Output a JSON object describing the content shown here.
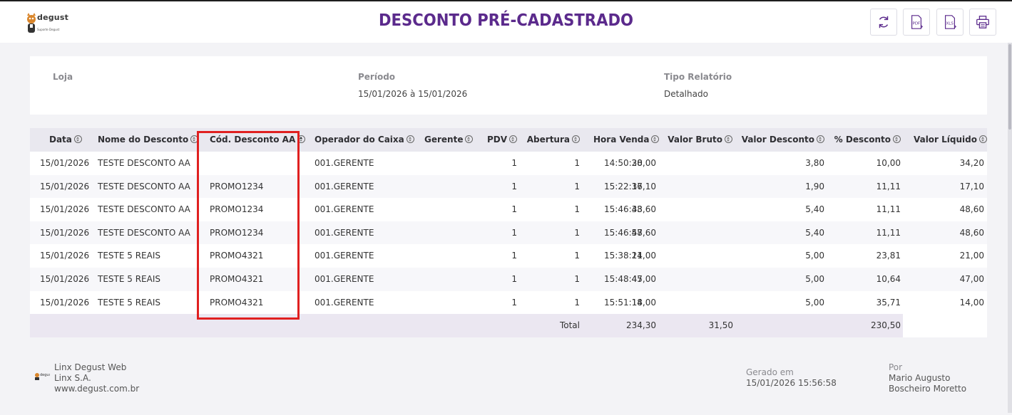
{
  "header": {
    "brand": "degust",
    "brand_sub": "Suporte Degust",
    "title": "DESCONTO PRÉ-CADASTRADO",
    "buttons": [
      "refresh-icon",
      "pdf-icon",
      "xls-icon",
      "print-icon"
    ]
  },
  "filters": {
    "loja_label": "Loja",
    "loja_value": "",
    "periodo_label": "Período",
    "periodo_value": "15/01/2026 à 15/01/2026",
    "tipo_label": "Tipo Relatório",
    "tipo_value": "Detalhado"
  },
  "table": {
    "columns": [
      "Data",
      "Nome do Desconto",
      "Cód. Desconto AA",
      "Operador do Caixa",
      "Gerente",
      "PDV",
      "Abertura",
      "Hora Venda",
      "Valor Bruto",
      "Valor Desconto",
      "% Desconto",
      "Valor Líquido"
    ],
    "rows": [
      [
        "15/01/2026",
        "TESTE DESCONTO AA",
        "",
        "001.GERENTE",
        "",
        "1",
        "1",
        "14:50:20",
        "38,00",
        "3,80",
        "10,00",
        "34,20"
      ],
      [
        "15/01/2026",
        "TESTE DESCONTO AA",
        "PROMO1234",
        "001.GERENTE",
        "",
        "1",
        "1",
        "15:22:36",
        "17,10",
        "1,90",
        "11,11",
        "17,10"
      ],
      [
        "15/01/2026",
        "TESTE DESCONTO AA",
        "PROMO1234",
        "001.GERENTE",
        "",
        "1",
        "1",
        "15:46:33",
        "48,60",
        "5,40",
        "11,11",
        "48,60"
      ],
      [
        "15/01/2026",
        "TESTE DESCONTO AA",
        "PROMO1234",
        "001.GERENTE",
        "",
        "1",
        "1",
        "15:46:57",
        "48,60",
        "5,40",
        "11,11",
        "48,60"
      ],
      [
        "15/01/2026",
        "TESTE 5 REAIS",
        "PROMO4321",
        "001.GERENTE",
        "",
        "1",
        "1",
        "15:38:14",
        "21,00",
        "5,00",
        "23,81",
        "21,00"
      ],
      [
        "15/01/2026",
        "TESTE 5 REAIS",
        "PROMO4321",
        "001.GERENTE",
        "",
        "1",
        "1",
        "15:48:45",
        "47,00",
        "5,00",
        "10,64",
        "47,00"
      ],
      [
        "15/01/2026",
        "TESTE 5 REAIS",
        "PROMO4321",
        "001.GERENTE",
        "",
        "1",
        "1",
        "15:51:18",
        "14,00",
        "5,00",
        "35,71",
        "14,00"
      ]
    ],
    "total": {
      "label": "Total",
      "valor_bruto": "234,30",
      "valor_desconto": "31,50",
      "valor_liquido": "230,50"
    }
  },
  "footer": {
    "company": "Linx Degust Web",
    "company2": "Linx S.A.",
    "site": "www.degust.com.br",
    "generated_label": "Gerado em",
    "generated_value": "15/01/2026 15:56:58",
    "by_label": "Por",
    "by_name1": "Mario Augusto",
    "by_name2": "Boscheiro Moretto"
  },
  "colors": {
    "title": "#5b2a8c",
    "highlight": "#e02020",
    "header_row": "#e9e8ef"
  }
}
